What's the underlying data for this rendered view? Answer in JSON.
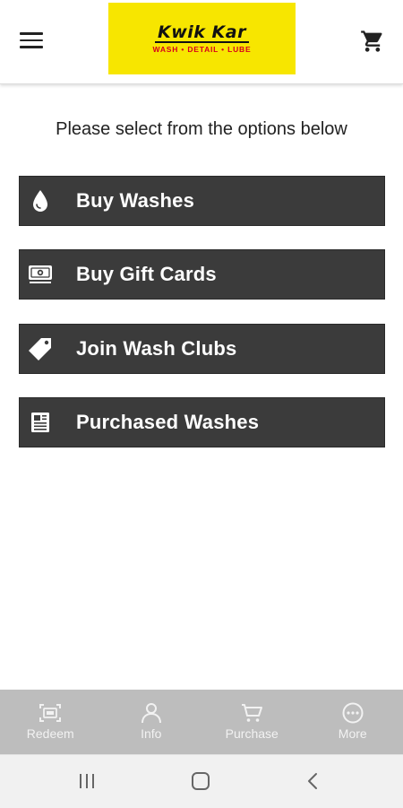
{
  "header": {
    "logo": {
      "name": "Kwik Kar",
      "tagline": "WASH • DETAIL • LUBE"
    },
    "menu_icon": "hamburger-menu-icon",
    "cart_icon": "shopping-cart-icon"
  },
  "main": {
    "instructions": "Please select from the options below",
    "options": [
      {
        "label": "Buy Washes",
        "icon": "water-drop-icon"
      },
      {
        "label": "Buy Gift Cards",
        "icon": "gift-card-icon"
      },
      {
        "label": "Join Wash Clubs",
        "icon": "tag-icon"
      },
      {
        "label": "Purchased Washes",
        "icon": "receipt-icon"
      }
    ]
  },
  "bottom_nav": {
    "items": [
      {
        "label": "Redeem",
        "icon": "scan-icon"
      },
      {
        "label": "Info",
        "icon": "person-icon"
      },
      {
        "label": "Purchase",
        "icon": "cart-icon"
      },
      {
        "label": "More",
        "icon": "more-icon"
      }
    ]
  },
  "colors": {
    "brand_yellow": "#f7e600",
    "brand_red": "#d6001c",
    "button_bg": "#3b3b3b",
    "nav_bg": "#bdbdbd"
  }
}
